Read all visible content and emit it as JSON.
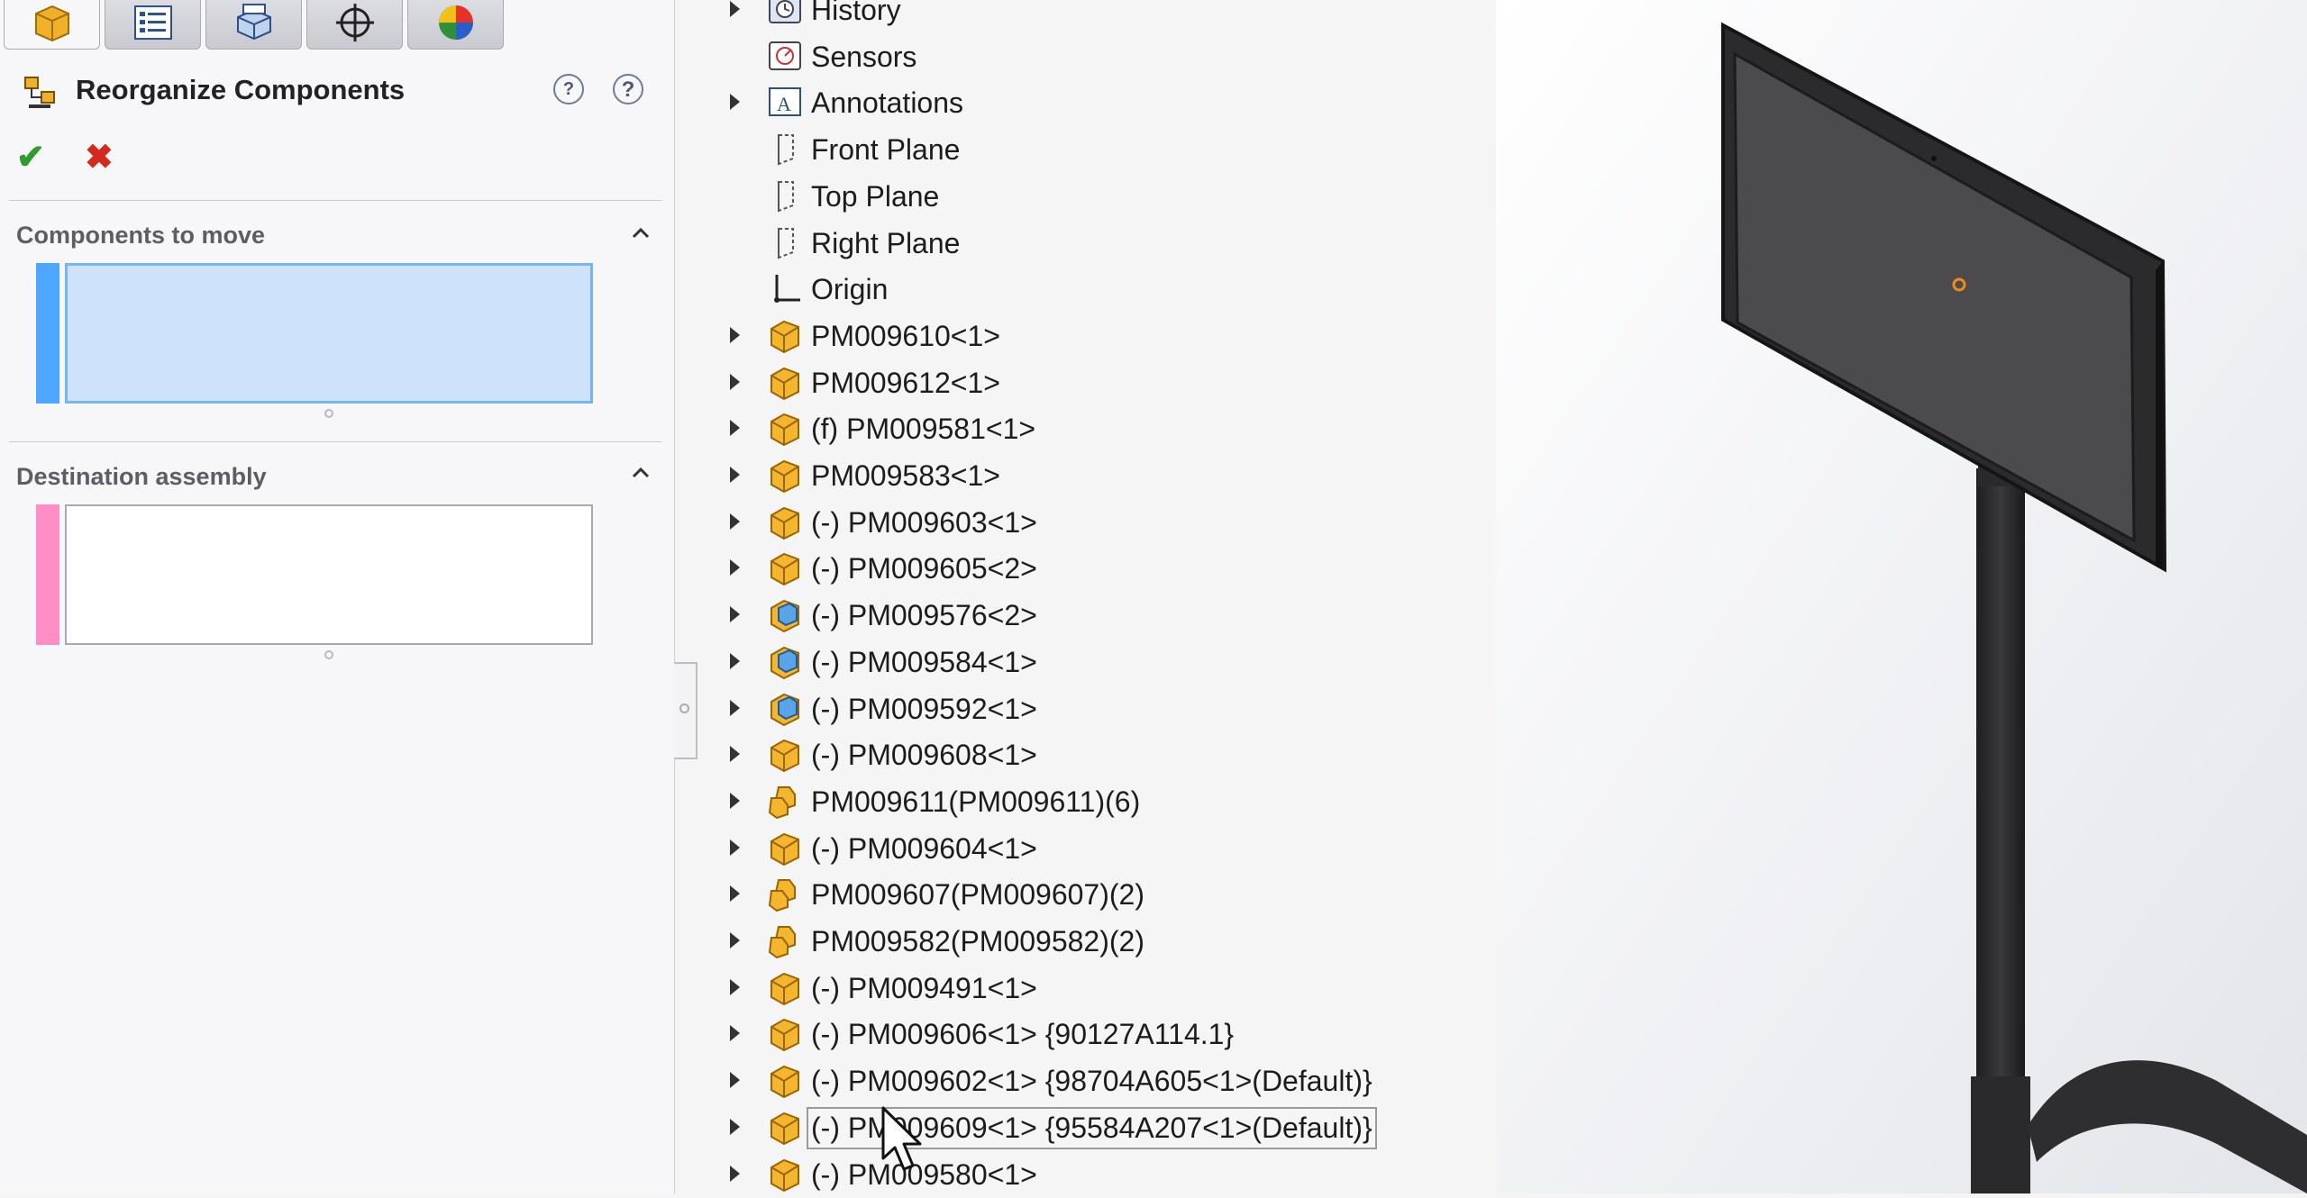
{
  "property_manager": {
    "tabs": [
      {
        "name": "feature-manager-tab",
        "icon": "part-cube-icon"
      },
      {
        "name": "property-manager-tab",
        "icon": "list-icon"
      },
      {
        "name": "configuration-manager-tab",
        "icon": "configuration-icon"
      },
      {
        "name": "dimxpert-tab",
        "icon": "crosshair-icon"
      },
      {
        "name": "display-manager-tab",
        "icon": "appearance-sphere-icon"
      }
    ],
    "title": "Reorganize Components",
    "ok_symbol": "✔",
    "cancel_symbol": "✖",
    "groups": {
      "components_to_move": {
        "title": "Components to move",
        "selection_color": "#4da6ff"
      },
      "destination_assembly": {
        "title": "Destination assembly",
        "selection_color": "#ff8ec6"
      }
    }
  },
  "feature_tree": {
    "items": [
      {
        "label": "History",
        "icon": "history-icon",
        "expandable": true
      },
      {
        "label": "Sensors",
        "icon": "sensor-icon",
        "expandable": false
      },
      {
        "label": "Annotations",
        "icon": "annotations-icon",
        "expandable": true
      },
      {
        "label": "Front Plane",
        "icon": "plane-icon",
        "expandable": false
      },
      {
        "label": "Top Plane",
        "icon": "plane-icon",
        "expandable": false
      },
      {
        "label": "Right Plane",
        "icon": "plane-icon",
        "expandable": false
      },
      {
        "label": "Origin",
        "icon": "origin-icon",
        "expandable": false
      },
      {
        "label": "PM009610<1>",
        "icon": "part-icon",
        "expandable": true
      },
      {
        "label": "PM009612<1>",
        "icon": "part-icon",
        "expandable": true
      },
      {
        "label": "(f) PM009581<1>",
        "icon": "part-icon",
        "expandable": true
      },
      {
        "label": "PM009583<1>",
        "icon": "part-icon",
        "expandable": true
      },
      {
        "label": "(-) PM009603<1>",
        "icon": "part-icon",
        "expandable": true
      },
      {
        "label": "(-) PM009605<2>",
        "icon": "part-icon",
        "expandable": true
      },
      {
        "label": "(-) PM009576<2>",
        "icon": "part-blue-icon",
        "expandable": true
      },
      {
        "label": "(-) PM009584<1>",
        "icon": "part-blue-icon",
        "expandable": true
      },
      {
        "label": "(-) PM009592<1>",
        "icon": "part-blue-icon",
        "expandable": true
      },
      {
        "label": "(-) PM009608<1>",
        "icon": "part-icon",
        "expandable": true
      },
      {
        "label": "PM009611(PM009611)(6)",
        "icon": "pattern-icon",
        "expandable": true
      },
      {
        "label": "(-) PM009604<1>",
        "icon": "part-icon",
        "expandable": true
      },
      {
        "label": "PM009607(PM009607)(2)",
        "icon": "pattern-icon",
        "expandable": true
      },
      {
        "label": "PM009582(PM009582)(2)",
        "icon": "pattern-icon",
        "expandable": true
      },
      {
        "label": "(-) PM009491<1>",
        "icon": "part-icon",
        "expandable": true
      },
      {
        "label": "(-) PM009606<1> {90127A114.1}",
        "icon": "part-icon",
        "expandable": true
      },
      {
        "label": "(-) PM009602<1> {98704A605<1>(Default)}",
        "icon": "part-icon",
        "expandable": true
      },
      {
        "label": "(-) PM009609<1> {95584A207<1>(Default)}",
        "icon": "part-icon",
        "expandable": true,
        "selected": true
      },
      {
        "label": "(-) PM009580<1>",
        "icon": "part-icon",
        "expandable": true
      }
    ]
  },
  "viewport": {
    "model": "monitor-on-pole-model",
    "background_color": "#f0f1f4",
    "model_color": "#2b2b2d"
  }
}
